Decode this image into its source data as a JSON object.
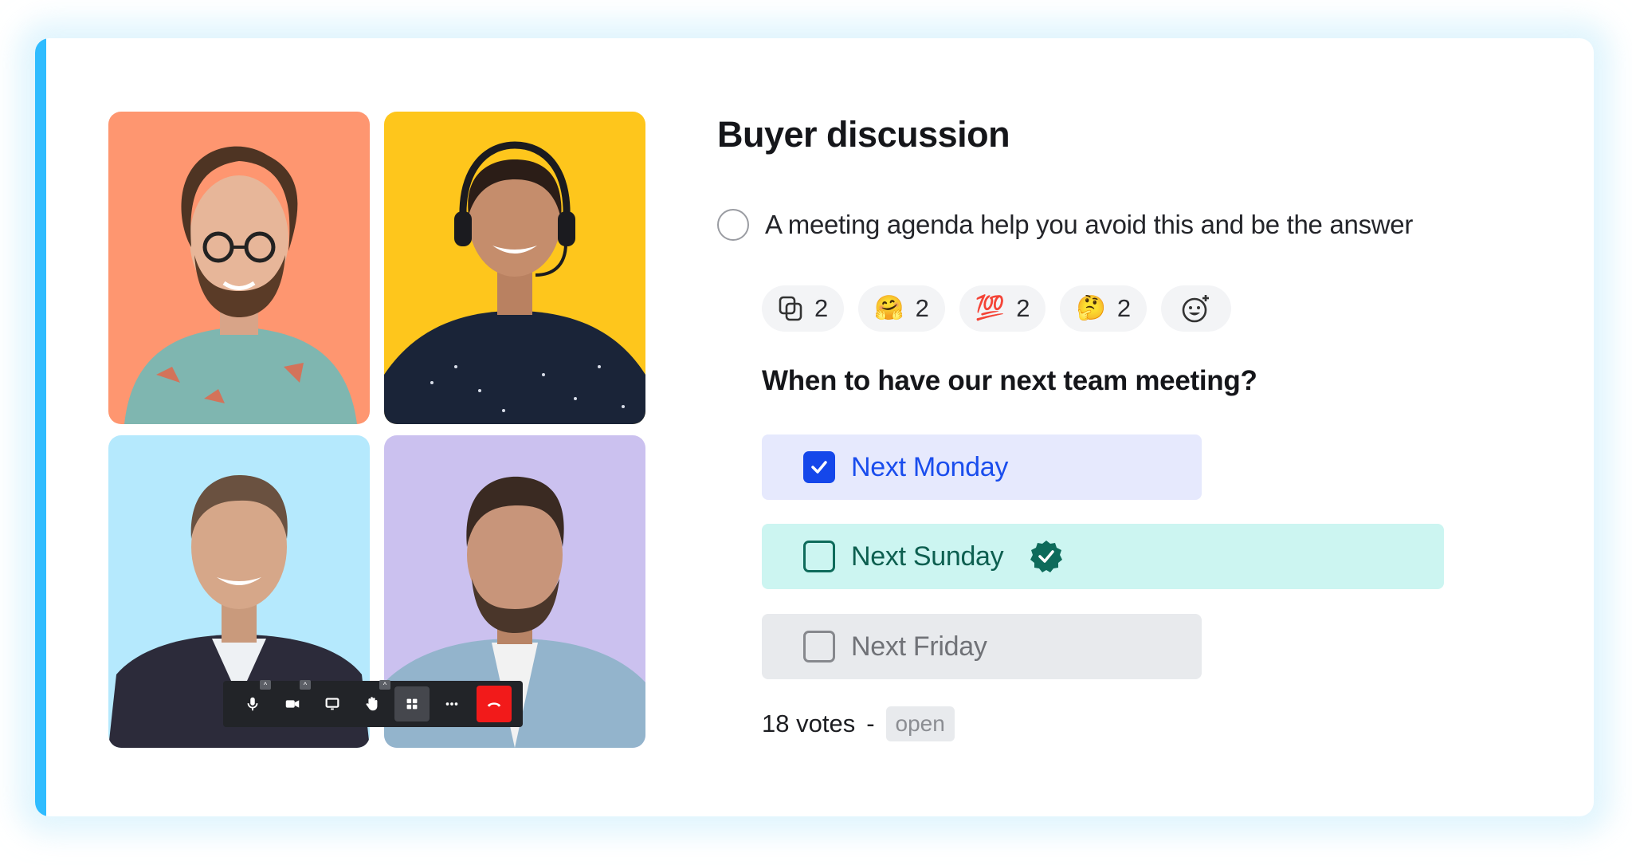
{
  "colors": {
    "accent_bar": "#2fbcff",
    "selected_option_bg": "#e6e9fd",
    "selected_option_text": "#1a4ded",
    "winning_option_bg": "#ccf5f1",
    "winning_option_text": "#0d5f50",
    "neutral_option_bg": "#e8eaed",
    "end_call": "#f21a1a"
  },
  "video_call": {
    "participants": [
      {
        "tile_bg": "#fe9670",
        "description": "curly-haired man with glasses"
      },
      {
        "tile_bg": "#fec61c",
        "description": "woman with headset"
      },
      {
        "tile_bg": "#b5e9fd",
        "description": "man in dark suit"
      },
      {
        "tile_bg": "#cbc1ef",
        "description": "bearded man in denim shirt"
      }
    ],
    "toolbar": [
      {
        "icon": "microphone-icon",
        "has_menu": true
      },
      {
        "icon": "camera-icon",
        "has_menu": true
      },
      {
        "icon": "screen-share-icon",
        "has_menu": false
      },
      {
        "icon": "raise-hand-icon",
        "has_menu": true
      },
      {
        "icon": "grid-view-icon",
        "has_menu": false,
        "active": true
      },
      {
        "icon": "more-icon",
        "has_menu": false
      },
      {
        "icon": "end-call-icon",
        "has_menu": false
      }
    ]
  },
  "discussion": {
    "title": "Buyer discussion",
    "question": "A meeting agenda help you avoid this and be the answer",
    "reactions": [
      {
        "icon": "copy-icon",
        "count": "2"
      },
      {
        "emoji": "🤗",
        "icon": "hugging-face-icon",
        "count": "2"
      },
      {
        "emoji": "💯",
        "icon": "hundred-points-icon",
        "count": "2"
      },
      {
        "emoji": "🤔",
        "icon": "thinking-face-icon",
        "count": "2"
      }
    ],
    "add_reaction_icon": "add-emoji-icon"
  },
  "poll": {
    "question": "When to have our next team meeting?",
    "options": [
      {
        "label": "Next Monday",
        "checked": true,
        "winner": false
      },
      {
        "label": "Next Sunday",
        "checked": false,
        "winner": true
      },
      {
        "label": "Next Friday",
        "checked": false,
        "winner": false
      }
    ],
    "votes": "18 votes",
    "separator": "-",
    "status": "open"
  }
}
